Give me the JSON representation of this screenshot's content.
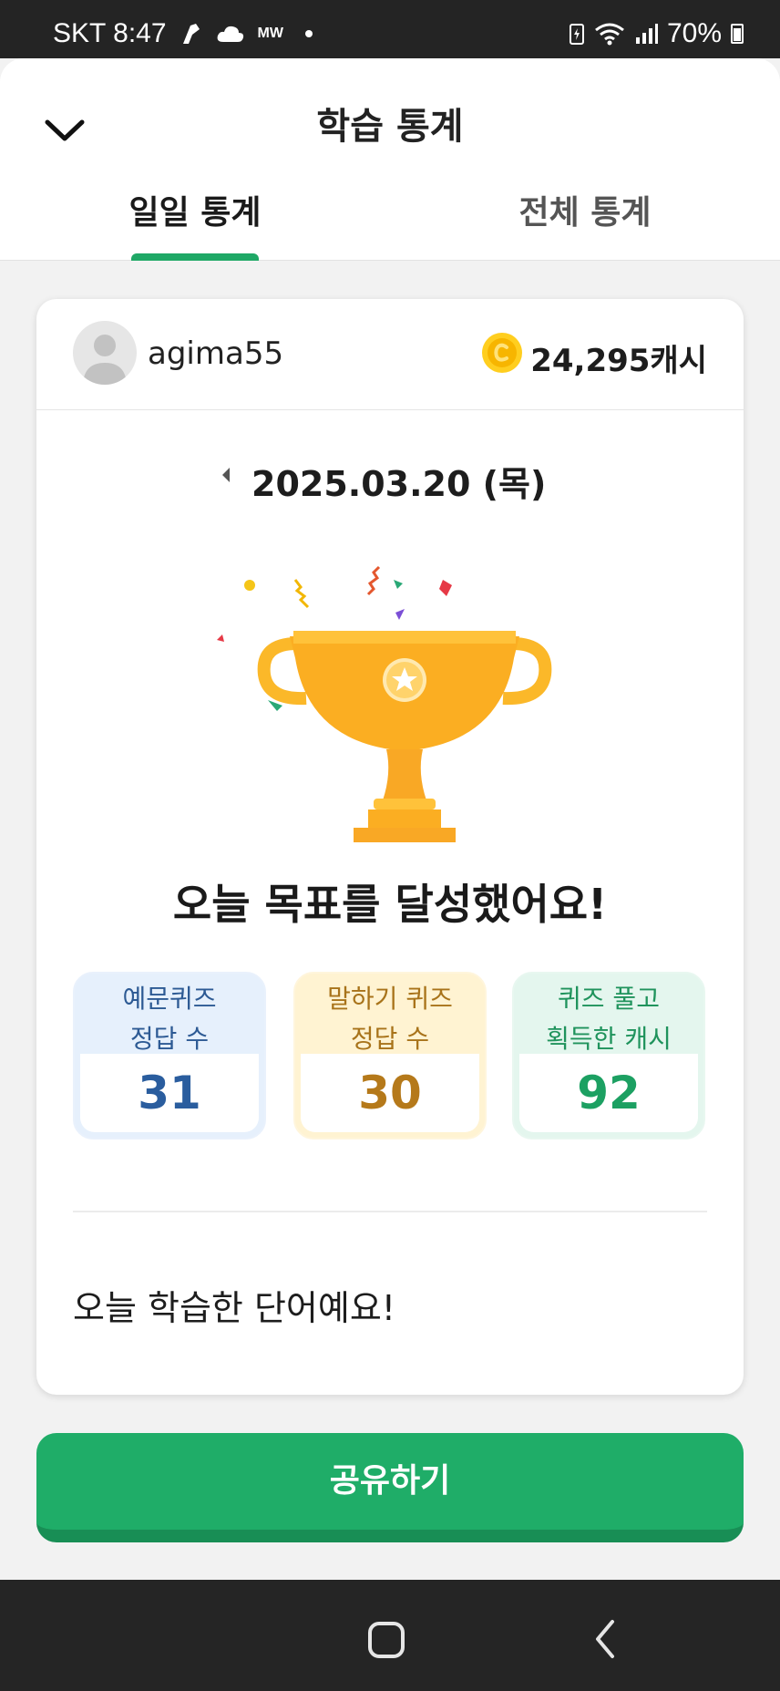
{
  "status_bar": {
    "carrier_time": "SKT 8:47",
    "network_label": "MW",
    "battery": "70%"
  },
  "header": {
    "title": "학습 통계",
    "close_icon": "chevron-down-icon"
  },
  "tabs": [
    {
      "label": "일일 통계",
      "active": true
    },
    {
      "label": "전체 통계",
      "active": false
    }
  ],
  "profile": {
    "username": "agima55",
    "cash": "24,295캐시",
    "coin_icon": "coin-icon"
  },
  "date": {
    "text": "2025.03.20 (목)",
    "prev_icon": "caret-left-icon"
  },
  "goal_message": "오늘 목표를 달성했어요!",
  "stats": [
    {
      "line1": "예문퀴즈",
      "line2": "정답 수",
      "value": "31",
      "color": "#2a5d9e"
    },
    {
      "line1": "말하기 퀴즈",
      "line2": "정답 수",
      "value": "30",
      "color": "#b5791a"
    },
    {
      "line1": "퀴즈 풀고",
      "line2": "획득한 캐시",
      "value": "92",
      "color": "#1ca062"
    }
  ],
  "words_title": "오늘 학습한 단어예요!",
  "share_button": "공유하기",
  "colors": {
    "accent": "#1fad68",
    "tab_indicator": "#1fa866",
    "trophy": "#f9a825"
  }
}
